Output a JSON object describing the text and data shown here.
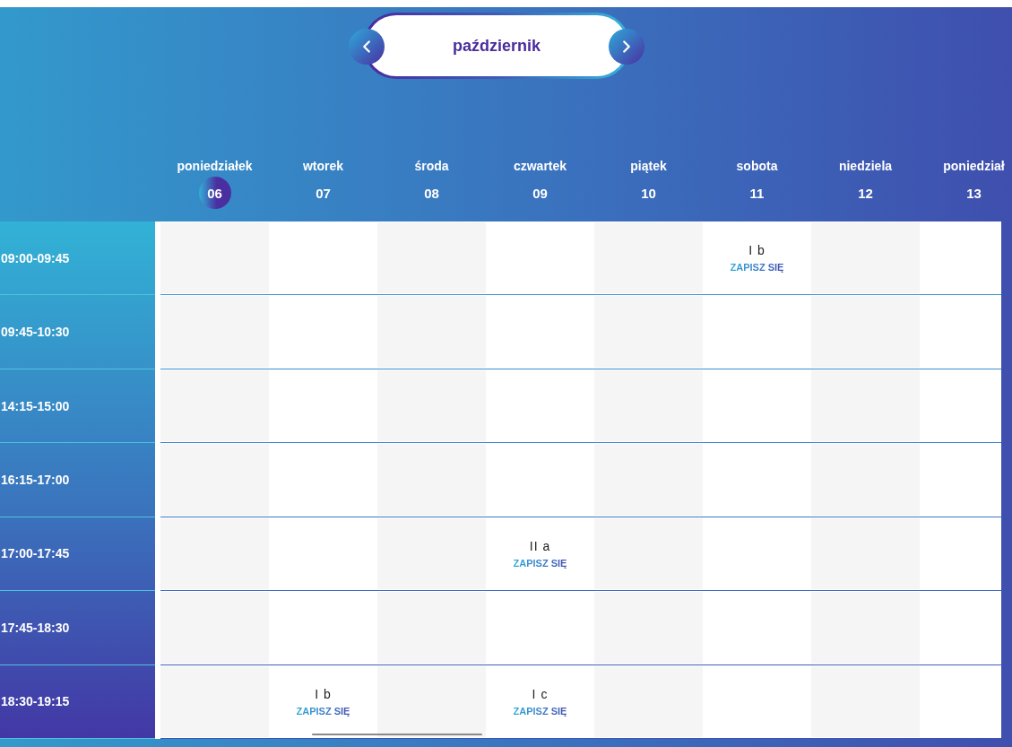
{
  "month_nav": {
    "month": "październik"
  },
  "days": [
    {
      "name": "poniedziałek",
      "date": "06",
      "selected": true
    },
    {
      "name": "wtorek",
      "date": "07",
      "selected": false
    },
    {
      "name": "środa",
      "date": "08",
      "selected": false
    },
    {
      "name": "czwartek",
      "date": "09",
      "selected": false
    },
    {
      "name": "piątek",
      "date": "10",
      "selected": false
    },
    {
      "name": "sobota",
      "date": "11",
      "selected": false
    },
    {
      "name": "niedziela",
      "date": "12",
      "selected": false
    },
    {
      "name": "poniedział",
      "date": "13",
      "selected": false
    }
  ],
  "time_slots": [
    {
      "time": "09:00-09:45",
      "cells": [
        {
          "kind": "empty"
        },
        {
          "kind": "empty"
        },
        {
          "kind": "empty"
        },
        {
          "kind": "empty"
        },
        {
          "kind": "empty"
        },
        {
          "kind": "event",
          "group": "I b",
          "link": "ZAPISZ SIĘ"
        },
        {
          "kind": "empty"
        },
        {
          "kind": "empty"
        }
      ]
    },
    {
      "time": "09:45-10:30",
      "cells": [
        {
          "kind": "empty"
        },
        {
          "kind": "empty"
        },
        {
          "kind": "empty"
        },
        {
          "kind": "empty"
        },
        {
          "kind": "empty"
        },
        {
          "kind": "empty"
        },
        {
          "kind": "empty"
        },
        {
          "kind": "empty"
        }
      ]
    },
    {
      "time": "14:15-15:00",
      "cells": [
        {
          "kind": "empty"
        },
        {
          "kind": "empty"
        },
        {
          "kind": "empty"
        },
        {
          "kind": "empty"
        },
        {
          "kind": "empty"
        },
        {
          "kind": "empty"
        },
        {
          "kind": "empty"
        },
        {
          "kind": "empty"
        }
      ]
    },
    {
      "time": "16:15-17:00",
      "cells": [
        {
          "kind": "empty"
        },
        {
          "kind": "empty"
        },
        {
          "kind": "empty"
        },
        {
          "kind": "empty"
        },
        {
          "kind": "empty"
        },
        {
          "kind": "empty"
        },
        {
          "kind": "empty"
        },
        {
          "kind": "empty"
        }
      ]
    },
    {
      "time": "17:00-17:45",
      "cells": [
        {
          "kind": "empty"
        },
        {
          "kind": "empty"
        },
        {
          "kind": "empty"
        },
        {
          "kind": "event",
          "group": "II a",
          "link": "ZAPISZ SIĘ"
        },
        {
          "kind": "empty"
        },
        {
          "kind": "empty"
        },
        {
          "kind": "empty"
        },
        {
          "kind": "empty"
        }
      ]
    },
    {
      "time": "17:45-18:30",
      "cells": [
        {
          "kind": "empty"
        },
        {
          "kind": "empty"
        },
        {
          "kind": "empty"
        },
        {
          "kind": "empty"
        },
        {
          "kind": "empty"
        },
        {
          "kind": "empty"
        },
        {
          "kind": "empty"
        },
        {
          "kind": "empty"
        }
      ]
    },
    {
      "time": "18:30-19:15",
      "cells": [
        {
          "kind": "empty"
        },
        {
          "kind": "event",
          "group": "I b",
          "link": "ZAPISZ SIĘ"
        },
        {
          "kind": "empty"
        },
        {
          "kind": "event",
          "group": "I c",
          "link": "ZAPISZ SIĘ"
        },
        {
          "kind": "empty"
        },
        {
          "kind": "empty"
        },
        {
          "kind": "empty"
        },
        {
          "kind": "empty"
        }
      ]
    }
  ]
}
